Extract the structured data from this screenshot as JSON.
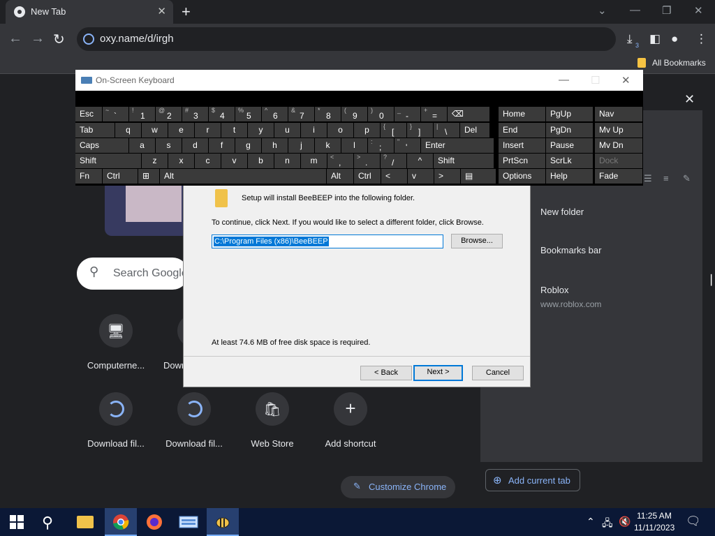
{
  "browser": {
    "tab_title": "New Tab",
    "url": "oxy.name/d/irgh",
    "download_badge": "3",
    "bookmarks_bar_item": "All Bookmarks"
  },
  "ntp": {
    "search_placeholder": "Search Google",
    "shortcuts": [
      {
        "label": "Computerne...",
        "icon": "computer-icon"
      },
      {
        "label": "Down",
        "icon": "download-icon"
      },
      {
        "label": "Download fil...",
        "icon": "globe-icon"
      },
      {
        "label": "Download fil...",
        "icon": "globe-icon"
      },
      {
        "label": "Web Store",
        "icon": "webstore-icon"
      },
      {
        "label": "Add shortcut",
        "icon": "plus-icon"
      }
    ],
    "customize_label": "Customize Chrome"
  },
  "side_panel": {
    "items": [
      {
        "title": "New folder"
      },
      {
        "title": "Bookmarks bar"
      },
      {
        "title": "Roblox",
        "url": "www.roblox.com"
      }
    ],
    "add_current_tab": "Add current tab"
  },
  "setup": {
    "intro": "Setup will install BeeBEEP into the following folder.",
    "instructions": "To continue, click Next. If you would like to select a different folder, click Browse.",
    "path": "C:\\Program Files (x86)\\BeeBEEP",
    "browse_label": "Browse...",
    "disk_space": "At least 74.6 MB of free disk space is required.",
    "back_label": "< Back",
    "next_label": "Next >",
    "cancel_label": "Cancel"
  },
  "osk": {
    "title": "On-Screen Keyboard",
    "row1": [
      [
        "Esc",
        ""
      ],
      [
        "`",
        "~"
      ],
      [
        "1",
        "!"
      ],
      [
        "2",
        "@"
      ],
      [
        "3",
        "#"
      ],
      [
        "4",
        "$"
      ],
      [
        "5",
        "%"
      ],
      [
        "6",
        "^"
      ],
      [
        "7",
        "&"
      ],
      [
        "8",
        "*"
      ],
      [
        "9",
        "("
      ],
      [
        "0",
        ")"
      ],
      [
        "-",
        "_"
      ],
      [
        "=",
        "+"
      ],
      [
        "⌫",
        ""
      ]
    ],
    "row2": [
      "Tab",
      "q",
      "w",
      "e",
      "r",
      "t",
      "y",
      "u",
      "i",
      "o",
      "p",
      "[",
      "]",
      "\\",
      "Del"
    ],
    "row2_shift": [
      "",
      "",
      "",
      "",
      "",
      "",
      "",
      "",
      "",
      "",
      "",
      "{",
      "}",
      "|",
      ""
    ],
    "row3": [
      "Caps",
      "a",
      "s",
      "d",
      "f",
      "g",
      "h",
      "j",
      "k",
      "l",
      ";",
      "'",
      "Enter"
    ],
    "row3_shift": [
      "",
      "",
      "",
      "",
      "",
      "",
      "",
      "",
      "",
      "",
      ":",
      "\"",
      ""
    ],
    "row4": [
      "Shift",
      "z",
      "x",
      "c",
      "v",
      "b",
      "n",
      "m",
      ",",
      ".",
      "/",
      "^",
      "Shift"
    ],
    "row4_shift": [
      "",
      "",
      "",
      "",
      "",
      "",
      "",
      "",
      "<",
      ">",
      "?",
      "",
      ""
    ],
    "row5": [
      "Fn",
      "Ctrl",
      "⊞",
      "Alt",
      "Alt",
      "Ctrl",
      "<",
      "v",
      ">",
      "▤"
    ],
    "nav_keys": [
      [
        "Home",
        "PgUp",
        "Nav"
      ],
      [
        "End",
        "PgDn",
        "Mv Up"
      ],
      [
        "Insert",
        "Pause",
        "Mv Dn"
      ],
      [
        "PrtScn",
        "ScrLk",
        "Dock"
      ],
      [
        "Options",
        "Help",
        "Fade"
      ]
    ]
  },
  "taskbar": {
    "time": "11:25 AM",
    "date": "11/11/2023"
  }
}
